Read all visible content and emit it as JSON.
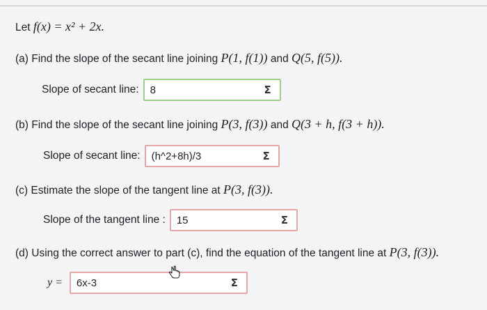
{
  "intro": {
    "text": "Let",
    "math": "f(x) = x² + 2x."
  },
  "parts": [
    {
      "prompt": "(a) Find the slope of the secant line joining",
      "math_segments": [
        "P(1, f(1))",
        "and",
        "Q(5, f(5))."
      ],
      "answer_label": "Slope of secant line:",
      "answer_value": "8",
      "answer_status": "correct"
    },
    {
      "prompt": "(b) Find the slope of the secant line joining",
      "math_segments": [
        "P(3, f(3))",
        "and",
        "Q(3 + h, f(3 + h))."
      ],
      "answer_label": "Slope of secant line:",
      "answer_value": "(h^2+8h)/3",
      "answer_status": "incorrect"
    },
    {
      "prompt": "(c) Estimate the slope of the tangent line at",
      "math_segments": [
        "P(3, f(3))."
      ],
      "answer_label": "Slope of the tangent line :",
      "answer_value": "15",
      "answer_status": "incorrect"
    },
    {
      "prompt": "(d) Using the correct answer to part (c), find the equation of the tangent line at",
      "math_segments": [
        "P(3, f(3))."
      ],
      "answer_label": "y =",
      "answer_value": "6x-3",
      "answer_status": "incorrect"
    }
  ],
  "sigma_symbol": "Σ",
  "icons": {
    "sigma": "sigma-icon",
    "cursor": "hand-pointer-icon"
  },
  "colors": {
    "correct_border": "#9ad08a",
    "incorrect_border": "#e7a6a6"
  }
}
